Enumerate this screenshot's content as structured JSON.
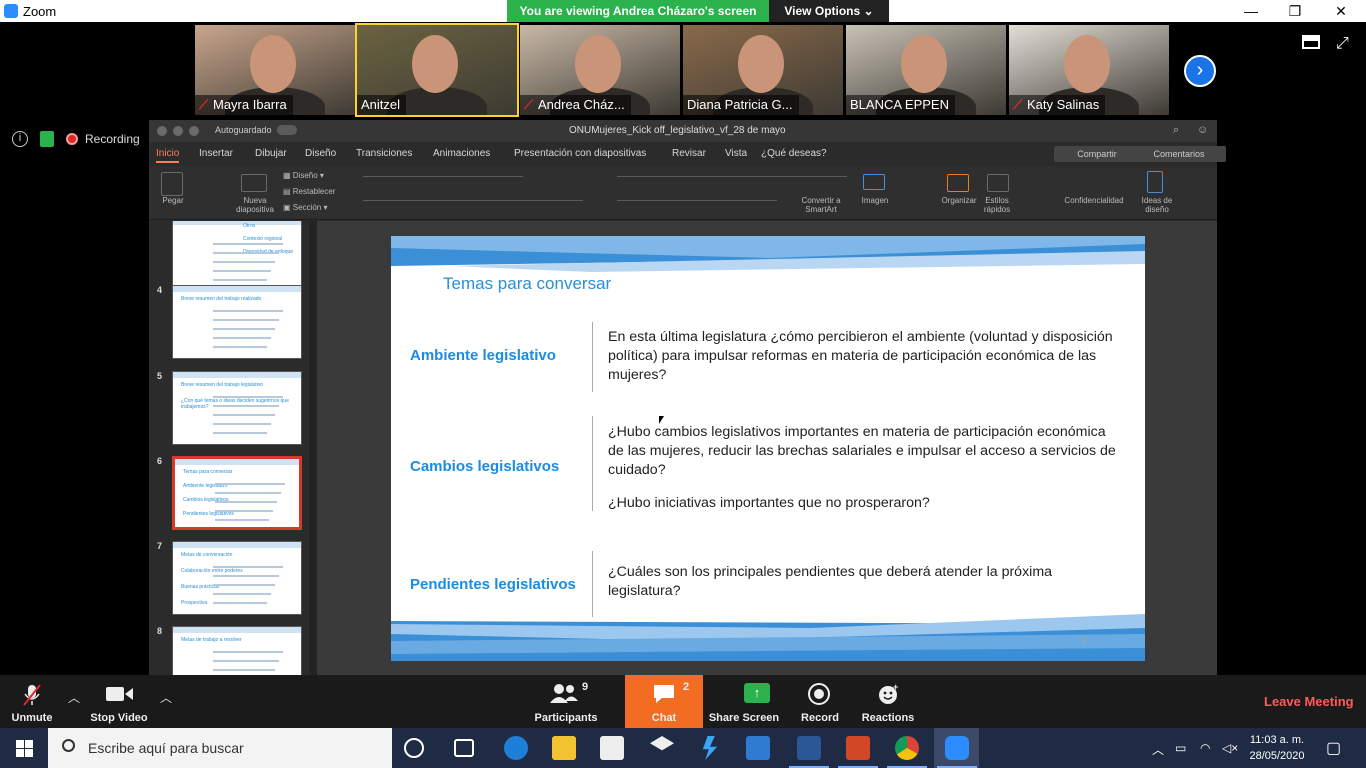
{
  "window": {
    "app_title": "Zoom",
    "viewing_banner": "You are viewing Andrea Cházaro's screen",
    "view_options": "View Options"
  },
  "participants": [
    {
      "name": "Mayra Ibarra",
      "muted": true,
      "color": "#c9a58c"
    },
    {
      "name": "Anitzel",
      "muted": false,
      "color": "#6b6440"
    },
    {
      "name": "Andrea Cház...",
      "muted": true,
      "color": "#c8b8a6"
    },
    {
      "name": "Diana Patricia G...",
      "muted": false,
      "color": "#8a6a4a"
    },
    {
      "name": "BLANCA EPPEN",
      "muted": false,
      "color": "#c8c1b6"
    },
    {
      "name": "Katy Salinas",
      "muted": true,
      "color": "#e3ddd5"
    }
  ],
  "meeting": {
    "recording_label": "Recording"
  },
  "ppt": {
    "autosave": "Autoguardado",
    "filename": "ONUMujeres_Kick off_legislativo_vf_28 de mayo",
    "tabs": [
      "Inicio",
      "Insertar",
      "Dibujar",
      "Diseño",
      "Transiciones",
      "Animaciones",
      "Presentación con diapositivas",
      "Revisar",
      "Vista",
      "¿Qué deseas?"
    ],
    "share": "Compartir",
    "comments": "Comentarios",
    "ribbon": {
      "paste": "Pegar",
      "new_slide": "Nueva diapositiva",
      "layout": "Diseño",
      "reset": "Restablecer",
      "section": "Sección",
      "convert": "Convertir a SmartArt",
      "image": "Imagen",
      "organize": "Organizar",
      "quick_styles": "Estilos rápidos",
      "confidentiality": "Confidencialidad",
      "design_ideas": "Ideas de diseño"
    },
    "thumbnails": [
      {
        "num": "",
        "lines": [
          "Otros",
          "Contexto regional",
          "Diversidad de enfoque"
        ]
      },
      {
        "num": "4",
        "lines": [
          "Breve resumen del trabajo realizado"
        ]
      },
      {
        "num": "5",
        "lines": [
          "Breve resumen del trabajo legislativo",
          "¿Con qué temas o ideas deciden sugerirnos que trabajemos?"
        ]
      },
      {
        "num": "6",
        "lines": [
          "Temas para conversar",
          "Ambiente legislativo",
          "Cambios legislativos",
          "Pendientes legislativos"
        ]
      },
      {
        "num": "7",
        "lines": [
          "Metas de conversación",
          "Colaboración entre poderes",
          "Buenas prácticas",
          "Prospectiva"
        ]
      },
      {
        "num": "8",
        "lines": [
          "Metas de trabajo a resolver"
        ]
      }
    ]
  },
  "slide": {
    "title": "Temas para conversar",
    "page_number": "6",
    "sections": [
      {
        "category": "Ambiente legislativo",
        "paragraphs": [
          "En esta última legislatura ¿cómo percibieron el ambiente (voluntad y disposición política) para impulsar reformas en materia de participación económica de las mujeres?"
        ]
      },
      {
        "category": "Cambios legislativos",
        "paragraphs": [
          "¿Hubo cambios legislativos importantes en materia de participación económica de las mujeres, reducir las brechas salariales e impulsar el acceso a servicios de cuidado?",
          "¿Hubo iniciativas importantes que no prosperaron?"
        ]
      },
      {
        "category": "Pendientes legislativos",
        "paragraphs": [
          "¿Cuáles son los principales pendientes que deberá atender la próxima legislatura?"
        ]
      }
    ]
  },
  "toolbar": {
    "unmute": "Unmute",
    "stop_video": "Stop Video",
    "participants": "Participants",
    "participants_count": "9",
    "chat": "Chat",
    "chat_count": "2",
    "share_screen": "Share Screen",
    "record": "Record",
    "reactions": "Reactions",
    "leave": "Leave Meeting"
  },
  "taskbar": {
    "search_placeholder": "Escribe aquí para buscar",
    "time": "11:03 a. m.",
    "date": "28/05/2020"
  }
}
